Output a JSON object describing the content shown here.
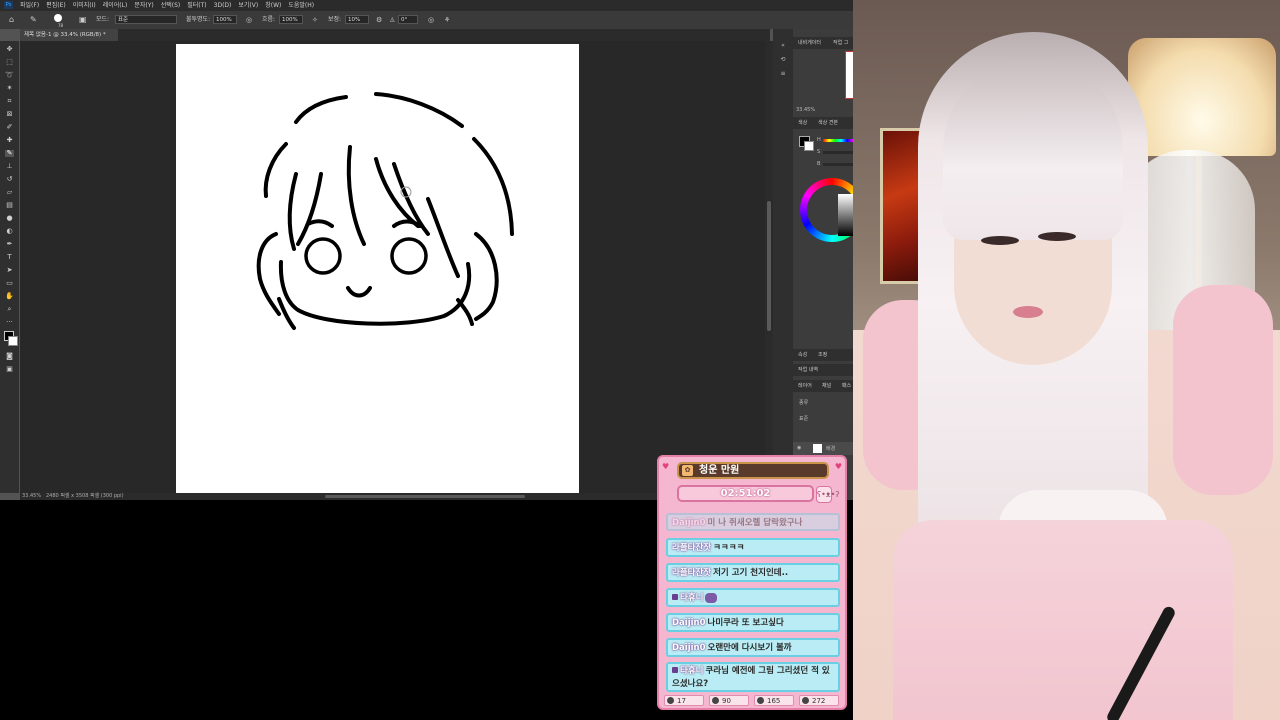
{
  "app": {
    "logo": "Ps",
    "menu": [
      "파일(F)",
      "편집(E)",
      "이미지(I)",
      "레이어(L)",
      "문자(Y)",
      "선택(S)",
      "필터(T)",
      "3D(D)",
      "보기(V)",
      "창(W)",
      "도움말(H)"
    ]
  },
  "options_bar": {
    "brush_size": "78",
    "mode_label": "모드:",
    "mode_value": "표준",
    "opacity_label": "불투명도:",
    "opacity_value": "100%",
    "flow_label": "흐름:",
    "flow_value": "100%",
    "smoothing_label": "보정:",
    "smoothing_value": "10%",
    "angle_value": "0°"
  },
  "document": {
    "tab_title": "제목 없음-1 @ 33.4% (RGB/8) *",
    "zoom": "33.45%",
    "info": "2480 픽셀 x 3508 픽셀 (300 ppi)"
  },
  "panels": {
    "navigator_tabs": [
      "내비게이터",
      "작업 그"
    ],
    "nav_zoom": "33.45%",
    "color_tabs": [
      "색상",
      "색상 견본"
    ],
    "channels_tabs": [
      "속성",
      "조정"
    ],
    "history_tab": "작업 내역",
    "layer_tabs": [
      "레이어",
      "채널",
      "패스"
    ],
    "layer_kind": "종류",
    "blend_mode": "표준",
    "layer_name": "배경",
    "color_letters": [
      "H",
      "S",
      "B"
    ]
  },
  "chat": {
    "title": "청운 만원",
    "timer": "02:51:02",
    "messages": [
      {
        "nick": "Daijin0",
        "text": "미 나 쥐새오렐 답락왔구나",
        "faded": true
      },
      {
        "nick": "라플타잔잣",
        "text": "ㅋㅋㅋㅋ",
        "faded": false
      },
      {
        "nick": "라플타잔잣",
        "text": "저기 고기 천지인데..",
        "faded": false
      },
      {
        "nick": "타휴니",
        "text": "",
        "faded": false
      },
      {
        "nick": "Daijin0",
        "text": "나미쿠라 또 보고싶다",
        "faded": false
      },
      {
        "nick": "Daijin0",
        "text": "오랜만에 다시보기 볼까",
        "faded": false
      },
      {
        "nick": "타휴니",
        "text": "쿠라님 예전에 그림 그리셨던 적 있으셨나요?",
        "faded": false
      }
    ],
    "stats": [
      "17",
      "90",
      "165",
      "272"
    ]
  },
  "colors": {
    "ps_bg": "#535353",
    "chat_pink": "#f5b6cf",
    "chat_msg_bg": "#b9ecf4",
    "chat_msg_border": "#6acfe2"
  }
}
